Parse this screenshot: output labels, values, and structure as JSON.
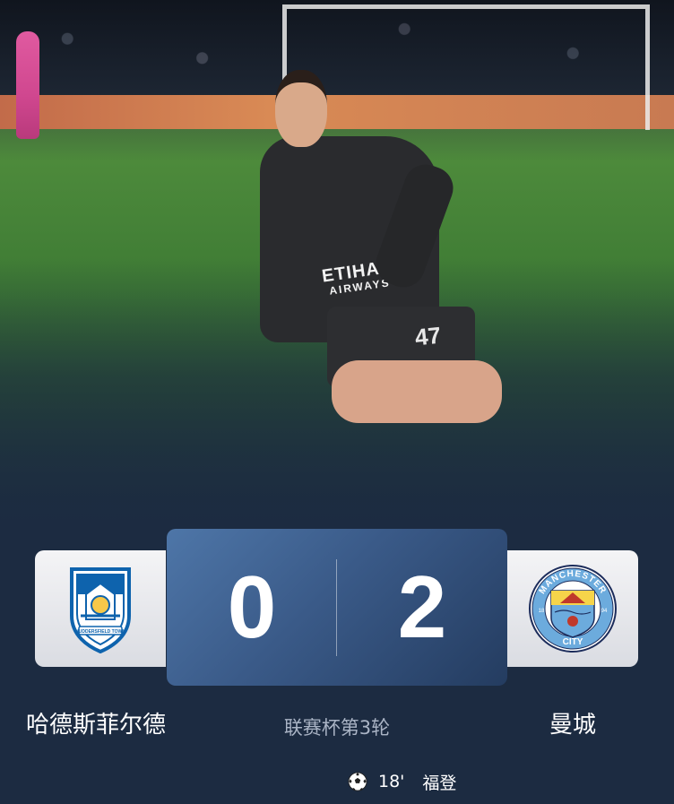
{
  "hero": {
    "sponsor_main": "ETIHAD",
    "sponsor_sub": "AIRWAYS",
    "shirt_number": "47"
  },
  "match": {
    "home": {
      "name": "哈德斯菲尔德",
      "score": "0",
      "crest_text": "HUDDERSFIELD TOWN"
    },
    "away": {
      "name": "曼城",
      "score": "2",
      "crest_top": "MANCHESTER",
      "crest_bottom": "CITY",
      "crest_left": "18",
      "crest_right": "94"
    },
    "competition": "联赛杯第3轮",
    "events": [
      {
        "icon": "soccer-ball-icon",
        "minute": "18'",
        "player": "福登"
      }
    ]
  },
  "colors": {
    "background": "#1c2b41",
    "score_box": "#3a5a88",
    "city_blue": "#6cabdd",
    "huddersfield_blue": "#0e63ad"
  }
}
